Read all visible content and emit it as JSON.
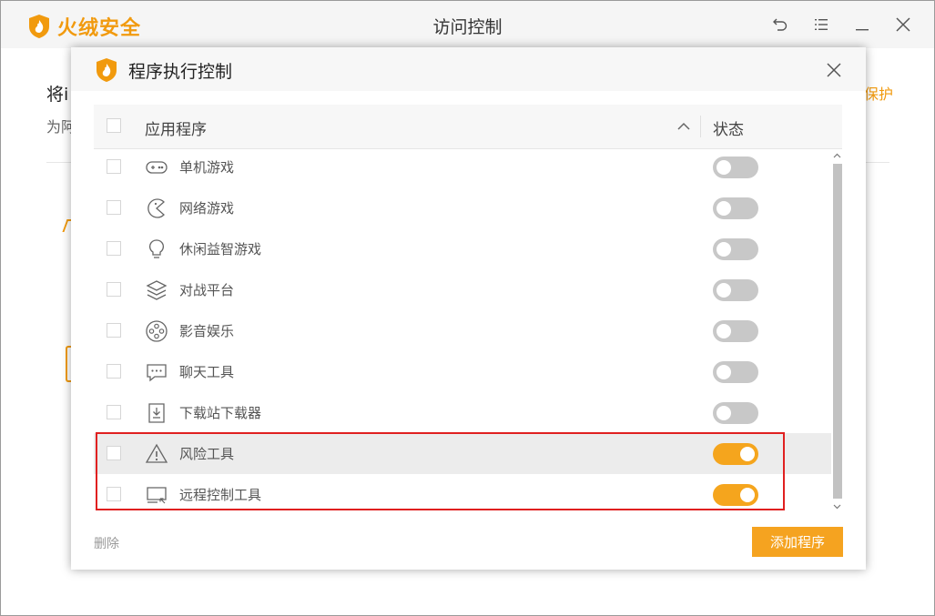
{
  "app": {
    "brand_name": "火绒安全",
    "window_title": "访问控制",
    "brand_color": "#f19a0e"
  },
  "background": {
    "heading_partial": "将i",
    "subtext_partial": "为阿",
    "link_partial": "保护"
  },
  "dialog": {
    "title": "程序执行控制",
    "header": {
      "col_app": "应用程序",
      "col_state": "状态"
    },
    "rows": [
      {
        "label": "单机游戏",
        "icon": "gamepad-icon",
        "enabled": false
      },
      {
        "label": "网络游戏",
        "icon": "pacman-icon",
        "enabled": false
      },
      {
        "label": "休闲益智游戏",
        "icon": "lightbulb-icon",
        "enabled": false
      },
      {
        "label": "对战平台",
        "icon": "layers-icon",
        "enabled": false
      },
      {
        "label": "影音娱乐",
        "icon": "film-reel-icon",
        "enabled": false
      },
      {
        "label": "聊天工具",
        "icon": "chat-bubble-icon",
        "enabled": false
      },
      {
        "label": "下载站下载器",
        "icon": "download-icon",
        "enabled": false
      },
      {
        "label": "风险工具",
        "icon": "warning-icon",
        "enabled": true
      },
      {
        "label": "远程控制工具",
        "icon": "remote-screen-icon",
        "enabled": true
      }
    ],
    "footer": {
      "delete_label": "删除",
      "add_label": "添加程序"
    },
    "colors": {
      "toggle_on": "#f5a51d",
      "toggle_off": "#c8c8c8",
      "highlight_border": "#e02020",
      "primary_button": "#f5a320"
    }
  }
}
